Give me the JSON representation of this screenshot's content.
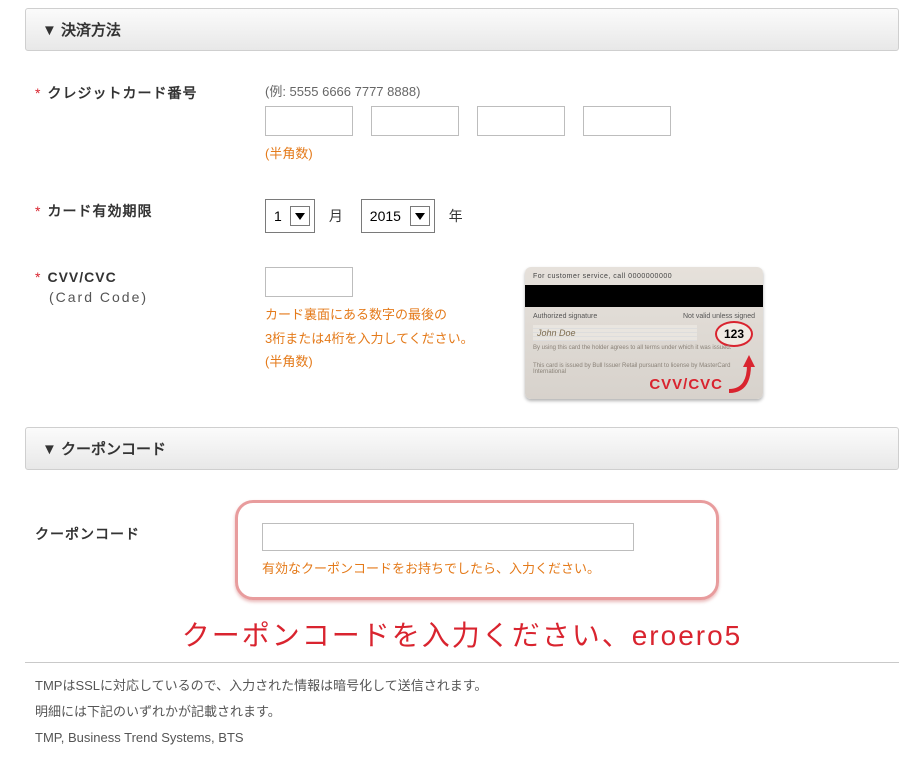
{
  "sections": {
    "payment_header": "▼ 決済方法",
    "coupon_header": "▼ クーポンコード"
  },
  "cc": {
    "label": "クレジットカード番号",
    "example": "(例: 5555 6666 7777 8888)",
    "half_width_note": "(半角数)",
    "seg1": "",
    "seg2": "",
    "seg3": "",
    "seg4": ""
  },
  "expiry": {
    "label": "カード有効期限",
    "month_value": "1",
    "month_unit": "月",
    "year_value": "2015",
    "year_unit": "年"
  },
  "cvv": {
    "label": "CVV/CVC",
    "sublabel": "(Card Code)",
    "value": "",
    "hint_line1": "カード裏面にある数字の最後の",
    "hint_line2": "3桁または4桁を入力してください。",
    "hint_line3": "(半角数)"
  },
  "card_illus": {
    "topline": "For customer service, call 0000000000",
    "sig_left": "Authorized signature",
    "sig_right": "Not valid unless signed",
    "signature": "John Doe",
    "cvv_sample": "123",
    "fine1": "By using this card the holder agrees to all terms under which it was issued.",
    "fine2": "This card is issued by Bull Issuer Retail pursuant to license by MasterCard International",
    "cvv_label": "CVV/CVC"
  },
  "coupon": {
    "label": "クーポンコード",
    "value": "",
    "hint": "有効なクーポンコードをお持ちでしたら、入力ください。"
  },
  "annotation": "クーポンコードを入力ください、eroero5",
  "footnotes": {
    "line1": "TMPはSSLに対応しているので、入力された情報は暗号化して送信されます。",
    "line2": "明細には下記のいずれかが記載されます。",
    "line3": "TMP, Business Trend Systems, BTS"
  }
}
